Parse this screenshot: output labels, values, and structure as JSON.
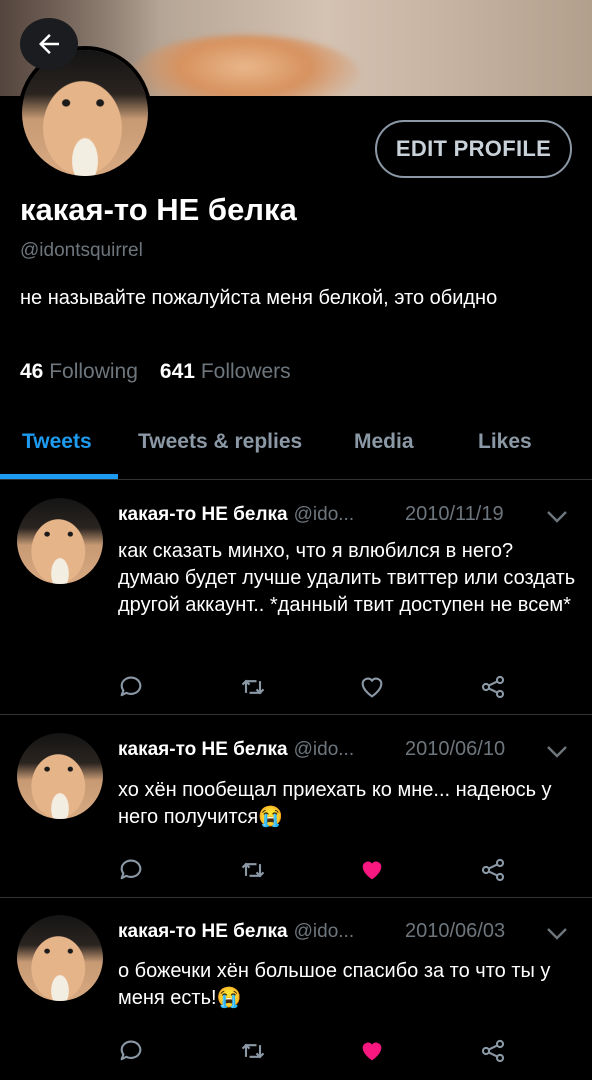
{
  "profile": {
    "display_name": "какая-то НЕ белка",
    "handle": "@idontsquirrel",
    "bio": "не называйте пожалуйста меня белкой, это обидно",
    "following_count": "46",
    "following_label": "Following",
    "followers_count": "641",
    "followers_label": "Followers",
    "edit_label": "EDIT PROFILE"
  },
  "tabs": [
    {
      "label": "Tweets",
      "active": true
    },
    {
      "label": "Tweets & replies",
      "active": false
    },
    {
      "label": "Media",
      "active": false
    },
    {
      "label": "Likes",
      "active": false
    }
  ],
  "tweets": [
    {
      "name": "какая-то НЕ белка",
      "handle": "@ido...",
      "date": "2010/11/19",
      "text": "как сказать минхо, что я влюбился в него? думаю будет лучше удалить твиттер или создать другой аккаунт.. *данный твит доступен не всем*",
      "liked": false
    },
    {
      "name": "какая-то НЕ белка",
      "handle": "@ido...",
      "date": "2010/06/10",
      "text": "хо хён пообещал приехать ко мне... надеюсь у него получится😭",
      "liked": true
    },
    {
      "name": "какая-то НЕ белка",
      "handle": "@ido...",
      "date": "2010/06/03",
      "text": "о божечки хён большое спасибо за то что ты у меня есть!😭",
      "liked": true
    }
  ],
  "colors": {
    "accent": "#1d9bf0",
    "like": "#f91880",
    "muted": "#6e767d",
    "background": "#000000"
  },
  "icons": [
    "back-arrow-icon",
    "chevron-down-icon",
    "reply-icon",
    "retweet-icon",
    "like-icon",
    "share-icon"
  ]
}
